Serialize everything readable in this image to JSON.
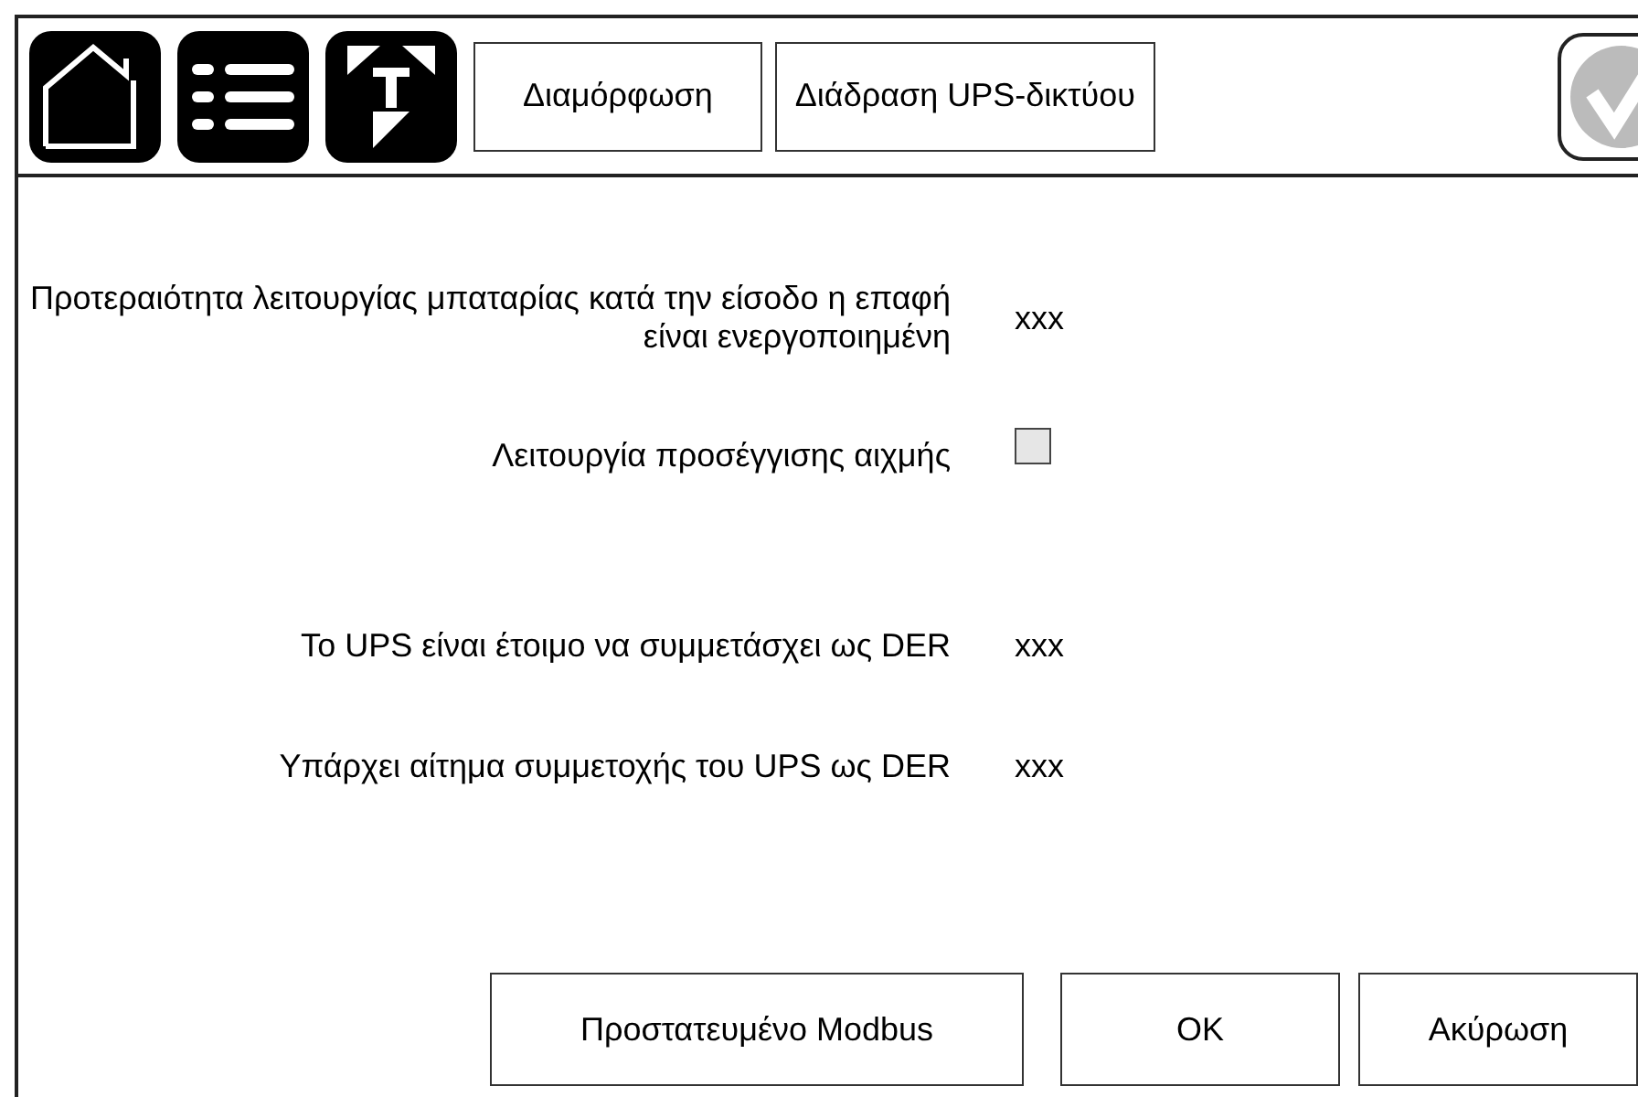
{
  "header": {
    "tabs": [
      {
        "label": "Διαμόρφωση",
        "selected": false
      },
      {
        "label": "Διάδραση UPS-δικτύου",
        "selected": false
      }
    ]
  },
  "settings": [
    {
      "kind": "value",
      "label": "Προτεραιότητα λειτουργίας μπαταρίας κατά την είσοδο η επαφή είναι ενεργοποιημένη",
      "value": "xxx"
    },
    {
      "kind": "checkbox",
      "label": "Λειτουργία προσέγγισης αιχμής",
      "checked": false
    },
    {
      "kind": "value",
      "label": "Το UPS είναι έτοιμο να συμμετάσχει ως DER",
      "value": "xxx"
    },
    {
      "kind": "value",
      "label": "Υπάρχει αίτημα συμμετοχής του UPS ως DER",
      "value": "xxx"
    }
  ],
  "buttons": [
    "Προστατευμένο Modbus",
    "OK",
    "Ακύρωση"
  ]
}
